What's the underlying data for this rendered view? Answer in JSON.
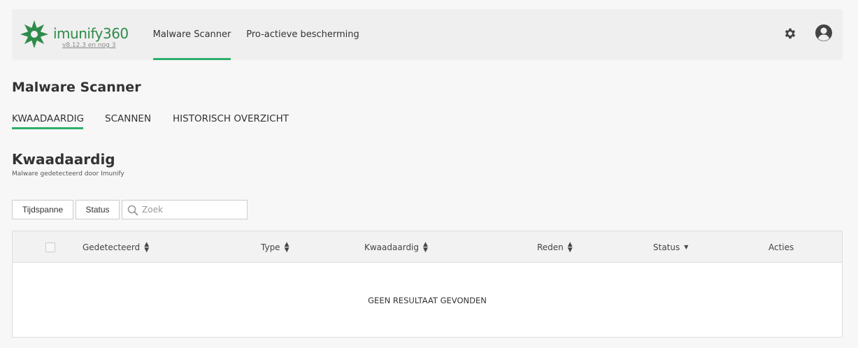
{
  "brand": {
    "name": "imunify",
    "number": "360",
    "version": "v8.12.3 en nog 3",
    "color": "#2e8b4a"
  },
  "nav": {
    "tabs": [
      {
        "label": "Malware Scanner",
        "active": true
      },
      {
        "label": "Pro-actieve bescherming",
        "active": false
      }
    ],
    "icons": [
      "gear-icon",
      "avatar-icon"
    ]
  },
  "page": {
    "title": "Malware Scanner"
  },
  "subtabs": [
    {
      "label": "KWAADAARDIG",
      "active": true
    },
    {
      "label": "SCANNEN",
      "active": false
    },
    {
      "label": "HISTORISCH OVERZICHT",
      "active": false
    }
  ],
  "section": {
    "title": "Kwaadaardig",
    "subtitle": "Malware gedetecteerd door Imunify"
  },
  "filters": {
    "timespan_label": "Tijdspanne",
    "status_label": "Status",
    "search_placeholder": "Zoek"
  },
  "table": {
    "columns": [
      {
        "label": "Gedetecteerd",
        "sort": "both"
      },
      {
        "label": "Type",
        "sort": "both"
      },
      {
        "label": "Kwaadaardig",
        "sort": "both"
      },
      {
        "label": "Reden",
        "sort": "both"
      },
      {
        "label": "Status",
        "sort": "down"
      },
      {
        "label": "Acties",
        "sort": "none"
      }
    ],
    "empty_message": "GEEN RESULTAAT GEVONDEN"
  },
  "colors": {
    "accent": "#2eaf6b",
    "background": "#f7f7f7",
    "header_bg": "#efefef"
  }
}
